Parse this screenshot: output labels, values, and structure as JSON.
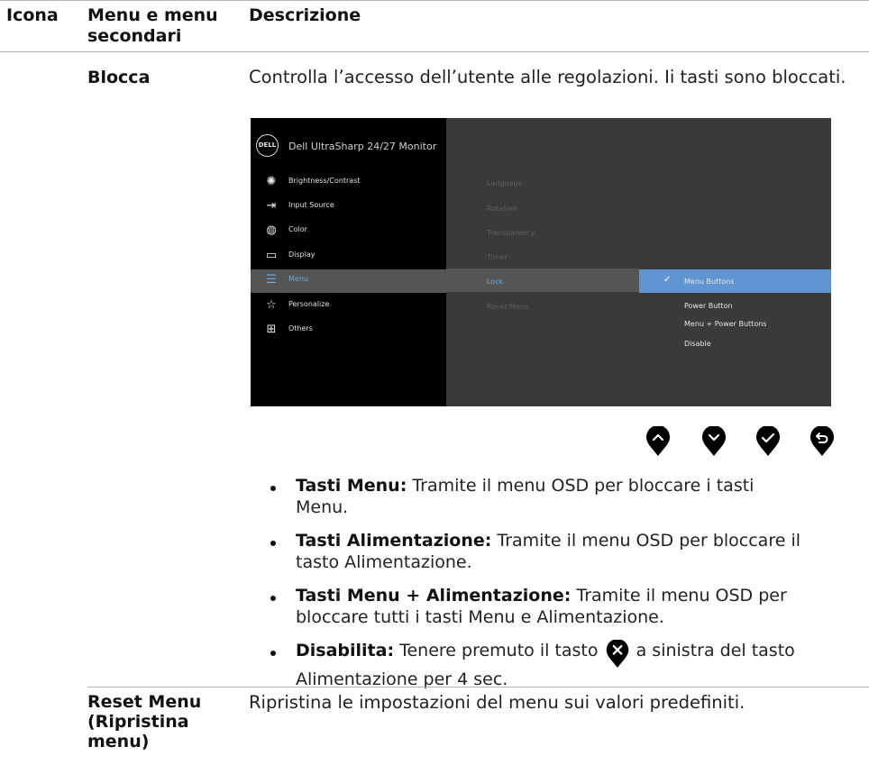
{
  "table_header": {
    "col_icon": "Icona",
    "col_menu": "Menu e menu secondari",
    "col_desc": "Descrizione"
  },
  "lock_row": {
    "name": "Blocca",
    "description": "Controlla l’accesso dell’utente alle regolazioni. Ii tasti sono bloccati."
  },
  "osd": {
    "logo": "DELL",
    "title": "Dell UltraSharp 24/27 Monitor",
    "menu_items": [
      {
        "label": "Brightness/Contrast",
        "icon": "brightness-icon"
      },
      {
        "label": "Input Source",
        "icon": "input-source-icon"
      },
      {
        "label": "Color",
        "icon": "color-icon"
      },
      {
        "label": "Display",
        "icon": "display-icon"
      },
      {
        "label": "Menu",
        "icon": "menu-icon"
      },
      {
        "label": "Personalize",
        "icon": "star-icon"
      },
      {
        "label": "Others",
        "icon": "others-icon"
      }
    ],
    "active_menu": "Menu",
    "sub_items": [
      "Language",
      "Rotation",
      "Transparency",
      "Timer",
      "Lock",
      "Reset Menu"
    ],
    "active_sub": "Lock",
    "options": [
      "Menu Buttons",
      "Power Button",
      "Menu + Power Buttons",
      "Disable"
    ],
    "selected_option": "Menu Buttons",
    "accent_color": "#5f95d0"
  },
  "buttons": [
    "up-arrow-button",
    "down-arrow-button",
    "check-button",
    "back-button"
  ],
  "bullets": [
    {
      "term": "Tasti Menu:",
      "text_line1": "Tramite il menu OSD per bloccare i tasti",
      "text_line2": "Menu."
    },
    {
      "term": "Tasti Alimentazione:",
      "text_line1": "Tramite il menu OSD per bloccare il",
      "text_line2": "tasto Alimentazione."
    },
    {
      "term": "Tasti Menu + Alimentazione:",
      "text_line1": "Tramite il menu OSD per",
      "text_line2": "bloccare tutti i tasti Menu e Alimentazione."
    },
    {
      "term": "Disabilita:",
      "text_pre": "Tenere premuto il tasto",
      "text_post": "a sinistra del tasto",
      "text_line2": "Alimentazione per 4 sec."
    }
  ],
  "reset_row": {
    "name_line1": "Reset Menu",
    "name_line2": "(Ripristina",
    "name_line3": "menu)",
    "description": "Ripristina le impostazioni del menu sui valori predefiniti."
  }
}
